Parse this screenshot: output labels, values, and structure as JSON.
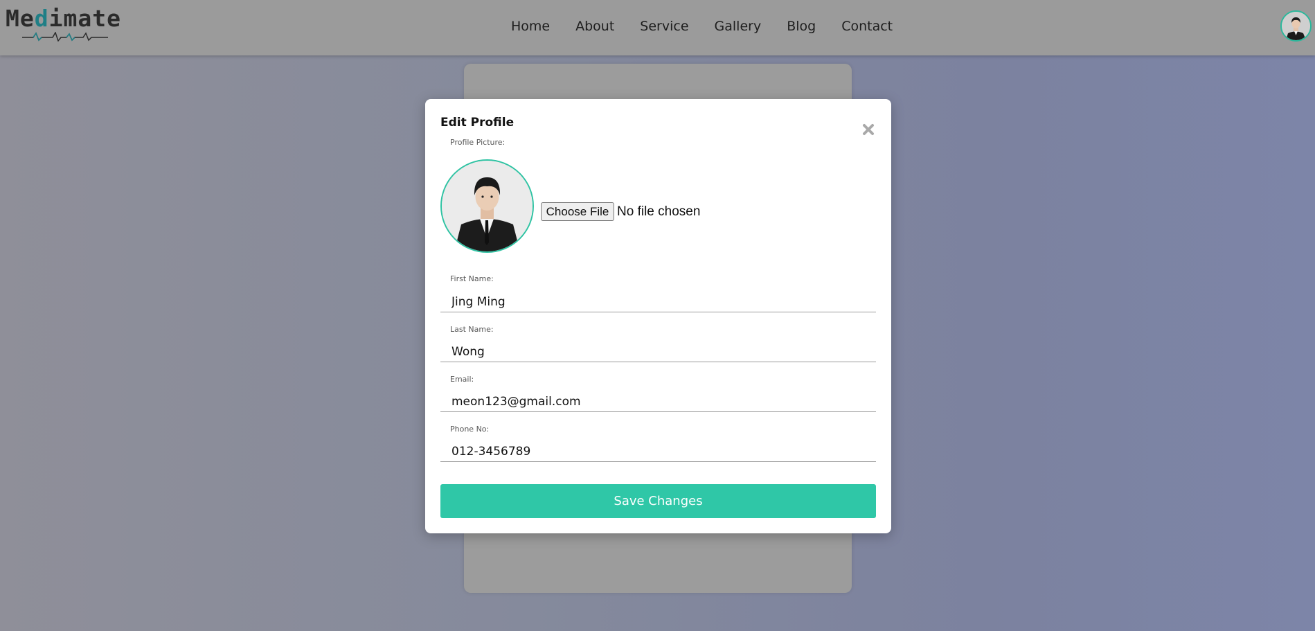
{
  "header": {
    "logo_prefix": "Me",
    "logo_accent": "d",
    "logo_suffix": "imate",
    "nav": [
      "Home",
      "About",
      "Service",
      "Gallery",
      "Blog",
      "Contact"
    ]
  },
  "modal": {
    "title": "Edit Profile",
    "profile_picture_label": "Profile Picture:",
    "choose_file_label": "Choose File",
    "file_status": "No file chosen",
    "fields": [
      {
        "label": "First Name:",
        "value": "Jing Ming"
      },
      {
        "label": "Last Name:",
        "value": "Wong"
      },
      {
        "label": "Email:",
        "value": "meon123@gmail.com"
      },
      {
        "label": "Phone No:",
        "value": "012-3456789"
      }
    ],
    "save_label": "Save Changes"
  },
  "colors": {
    "accent": "#2fc7a7",
    "logo_accent": "#1f7f86",
    "overlay": "#858a9c"
  },
  "icons": {
    "close": "close-icon",
    "heartbeat": "heartbeat-line-icon",
    "avatar": "user-avatar"
  }
}
